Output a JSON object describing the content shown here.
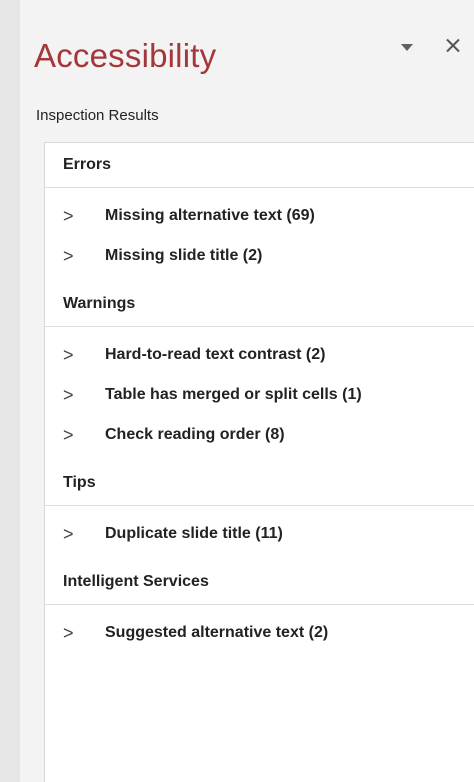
{
  "pane": {
    "title": "Accessibility",
    "options_icon": "chevron-down-icon",
    "close_icon": "close-icon",
    "section_label": "Inspection Results",
    "accent_color": "#a4373a"
  },
  "groups": [
    {
      "header": "Errors",
      "items": [
        {
          "icon": "chevron-right-icon",
          "label": "Missing alternative text (69)"
        },
        {
          "icon": "chevron-right-icon",
          "label": "Missing slide title (2)"
        }
      ]
    },
    {
      "header": "Warnings",
      "items": [
        {
          "icon": "chevron-right-icon",
          "label": "Hard-to-read text contrast (2)"
        },
        {
          "icon": "chevron-right-icon",
          "label": "Table has merged or split cells (1)"
        },
        {
          "icon": "chevron-right-icon",
          "label": "Check reading order (8)"
        }
      ]
    },
    {
      "header": "Tips",
      "items": [
        {
          "icon": "chevron-right-icon",
          "label": "Duplicate slide title (11)"
        }
      ]
    },
    {
      "header": "Intelligent Services",
      "items": [
        {
          "icon": "chevron-right-icon",
          "label": "Suggested alternative text (2)"
        }
      ]
    }
  ]
}
